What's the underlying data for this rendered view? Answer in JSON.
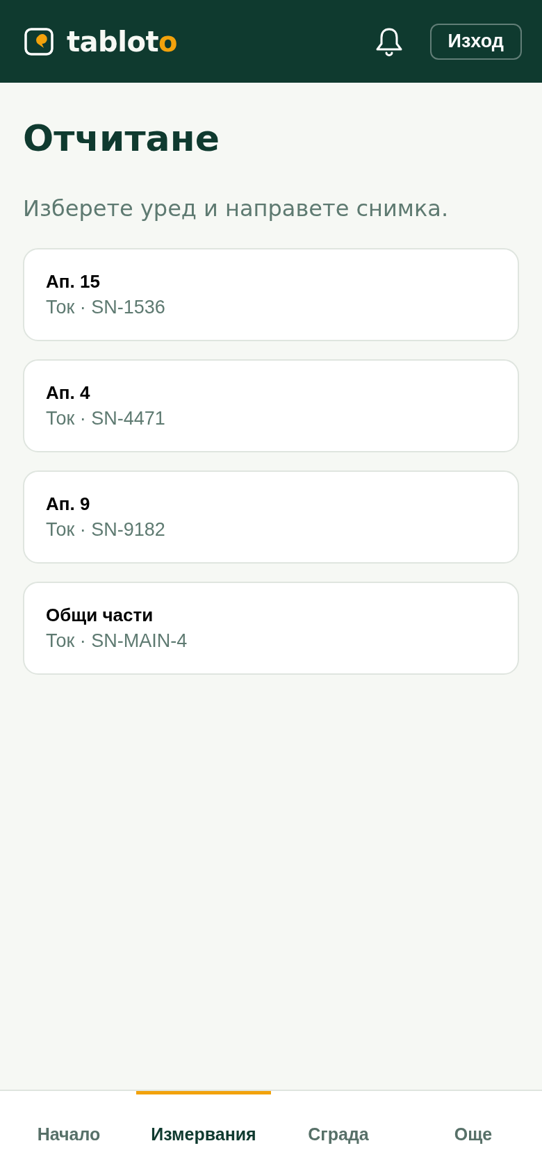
{
  "header": {
    "wordmark": "tablot",
    "wordmark_accent": "o",
    "logout_button": "Изход"
  },
  "page": {
    "title": "Отчитане",
    "subtitle": "Изберете уред и направете снимка."
  },
  "meters": [
    {
      "name": "Ап. 15",
      "details": "Ток · SN-1536"
    },
    {
      "name": "Ап. 4",
      "details": "Ток · SN-4471"
    },
    {
      "name": "Ап. 9",
      "details": "Ток · SN-9182"
    },
    {
      "name": "Общи части",
      "details": "Ток · SN-MAIN-4"
    }
  ],
  "bottom_nav": [
    {
      "label": "Начало",
      "selected": false
    },
    {
      "label": "Измервания",
      "selected": true
    },
    {
      "label": "Сграда",
      "selected": false
    },
    {
      "label": "Още",
      "selected": false
    }
  ]
}
